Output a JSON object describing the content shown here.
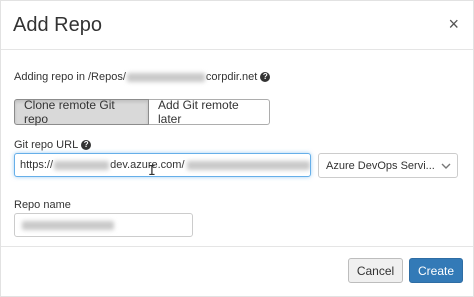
{
  "dialog": {
    "title": "Add Repo",
    "close_glyph": "×"
  },
  "info": {
    "prefix": "Adding repo in /Repos/",
    "suffix": "corpdir.net",
    "help_glyph": "?"
  },
  "mode_toggle": {
    "options": [
      {
        "label": "Clone remote Git repo",
        "selected": true
      },
      {
        "label": "Add Git remote later",
        "selected": false
      }
    ]
  },
  "git_url": {
    "label": "Git repo URL",
    "help_glyph": "?",
    "value_prefix": "https://",
    "value_middle": "dev.azure.com/",
    "provider_selected": "Azure DevOps Servi..."
  },
  "repo_name": {
    "label": "Repo name"
  },
  "footer": {
    "cancel_label": "Cancel",
    "create_label": "Create"
  },
  "colors": {
    "primary": "#337ab7",
    "focus": "#66afe9"
  }
}
